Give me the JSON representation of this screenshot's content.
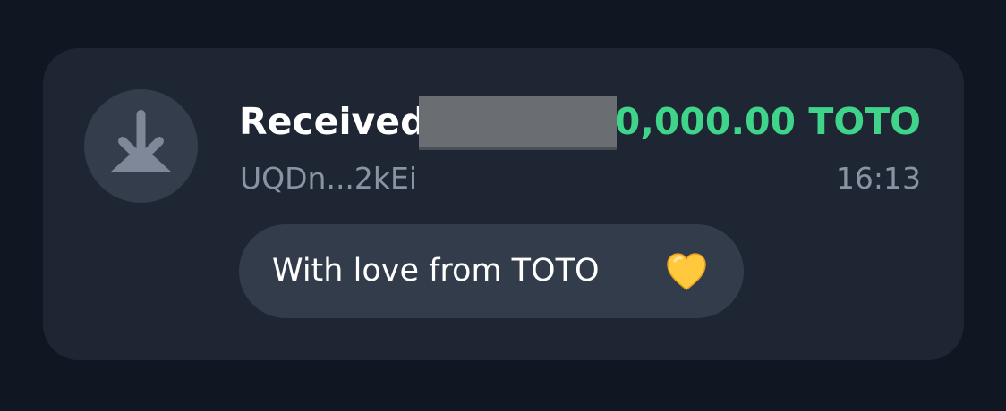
{
  "transaction": {
    "title": "Received",
    "amount": "0,000.00 TOTO",
    "address": "UQDn...2kEi",
    "time": "16:13",
    "comment": "With love from TOTO",
    "comment_emoji_icon": "yellow-heart-icon",
    "direction_icon": "download-arrow-icon"
  },
  "colors": {
    "background": "#111722",
    "card": "#1e2633",
    "icon_circle": "#343d4c",
    "amount_green": "#3fd489",
    "muted_text": "#8a93a4",
    "comment_bubble": "#333c4b"
  }
}
